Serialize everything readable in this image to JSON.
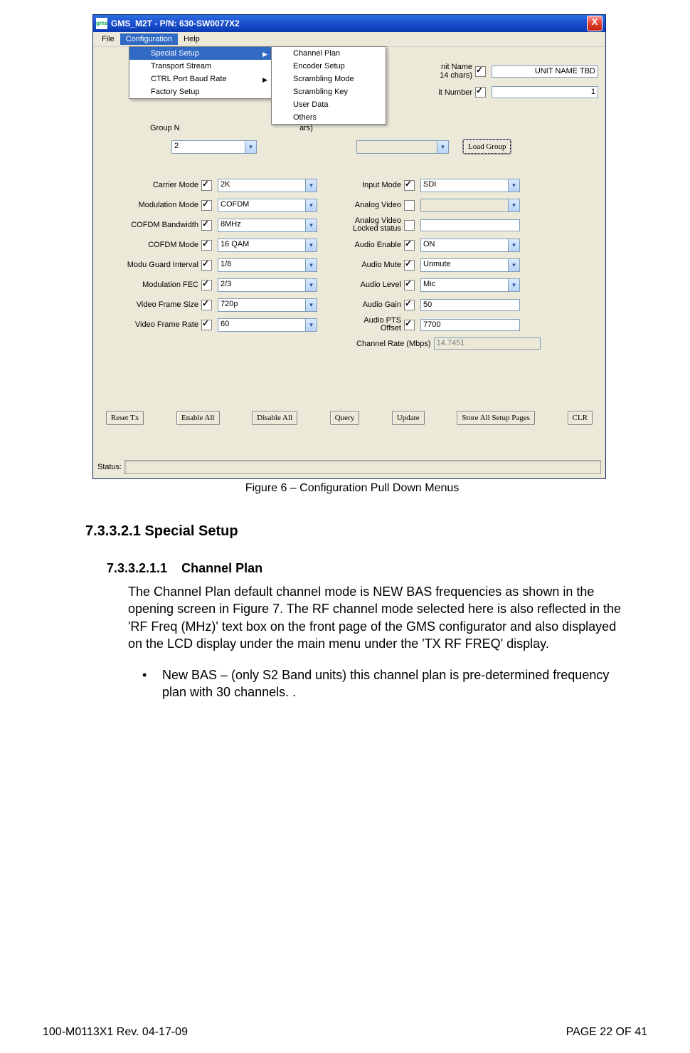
{
  "app": {
    "title": "GMS_M2T - P/N: 630-SW0077X2",
    "close_x": "X",
    "menubar": [
      "File",
      "Configuration",
      "Help"
    ],
    "menubar_open_index": 1,
    "dropdown1": [
      {
        "label": "Special Setup",
        "has_sub": true,
        "selected": true
      },
      {
        "label": "Transport Stream",
        "has_sub": false
      },
      {
        "label": "CTRL Port Baud Rate",
        "has_sub": true
      },
      {
        "label": "Factory Setup",
        "has_sub": false
      }
    ],
    "dropdown2": [
      "Channel Plan",
      "Encoder Setup",
      "Scrambling Mode",
      "Scrambling Key",
      "User Data",
      "Others"
    ],
    "top_fields": {
      "unit_name_label_1": "nit Name",
      "unit_name_label_2": "14 chars)",
      "unit_name_value": "UNIT NAME TBD",
      "unit_number_label": "it Number",
      "unit_number_value": "1"
    },
    "group": {
      "label_1": "Group N",
      "label_2": "ars)",
      "value": "2",
      "button": "Load Group"
    },
    "left_fields": [
      {
        "label": "Carrier Mode",
        "checked": true,
        "value": "2K",
        "combo": true
      },
      {
        "label": "Modulation Mode",
        "checked": true,
        "value": "COFDM",
        "combo": true
      },
      {
        "label": "COFDM Bandwidth",
        "checked": true,
        "value": "8MHz",
        "combo": true
      },
      {
        "label": "COFDM Mode",
        "checked": true,
        "value": "16 QAM",
        "combo": true
      },
      {
        "label": "Modu Guard Interval",
        "checked": true,
        "value": "1/8",
        "combo": true
      },
      {
        "label": "Modulation FEC",
        "checked": true,
        "value": "2/3",
        "combo": true
      },
      {
        "label": "Video Frame Size",
        "checked": true,
        "value": "720p",
        "combo": true
      },
      {
        "label": "Video Frame Rate",
        "checked": true,
        "value": "60",
        "combo": true
      }
    ],
    "right_fields": [
      {
        "label": "Input Mode",
        "checked": true,
        "value": "SDI",
        "combo": true
      },
      {
        "label": "Analog Video",
        "checked": false,
        "value": "",
        "combo": true,
        "disabled": true
      },
      {
        "label": "Analog Video\nLocked status",
        "checked": false,
        "value": "",
        "combo": false,
        "multiline": true
      },
      {
        "label": "Audio Enable",
        "checked": true,
        "value": "ON",
        "combo": true
      },
      {
        "label": "Audio Mute",
        "checked": true,
        "value": "Unmute",
        "combo": true
      },
      {
        "label": "Audio Level",
        "checked": true,
        "value": "Mic",
        "combo": true
      },
      {
        "label": "Audio Gain",
        "checked": true,
        "value": "50",
        "combo": false
      },
      {
        "label": "Audio PTS\nOffset",
        "checked": true,
        "value": "7700",
        "combo": false,
        "multiline": true
      }
    ],
    "channel_rate_label": "Channel Rate (Mbps)",
    "channel_rate_value": "14.7451",
    "buttons": [
      "Reset Tx",
      "Enable All",
      "Disable All",
      "Query",
      "Update",
      "Store All Setup Pages",
      "CLR"
    ],
    "status_label": "Status:"
  },
  "figure_caption": "Figure 6 – Configuration Pull Down Menus",
  "heading1": "7.3.3.2.1 Special Setup",
  "heading2_num": "7.3.3.2.1.1",
  "heading2_title": "Channel Plan",
  "paragraph": "The Channel Plan default channel mode is NEW BAS frequencies as shown in the opening screen in Figure 7. The RF channel mode selected here is also reflected in the 'RF Freq (MHz)' text box on the front page of the GMS configurator and also displayed on the LCD display under the main menu under the 'TX RF FREQ' display.",
  "bullet": "New BAS – (only S2 Band units) this channel plan is pre-determined frequency plan with 30 channels. .",
  "footer_left": "100-M0113X1 Rev. 04-17-09",
  "footer_right": "PAGE 22 OF 41"
}
